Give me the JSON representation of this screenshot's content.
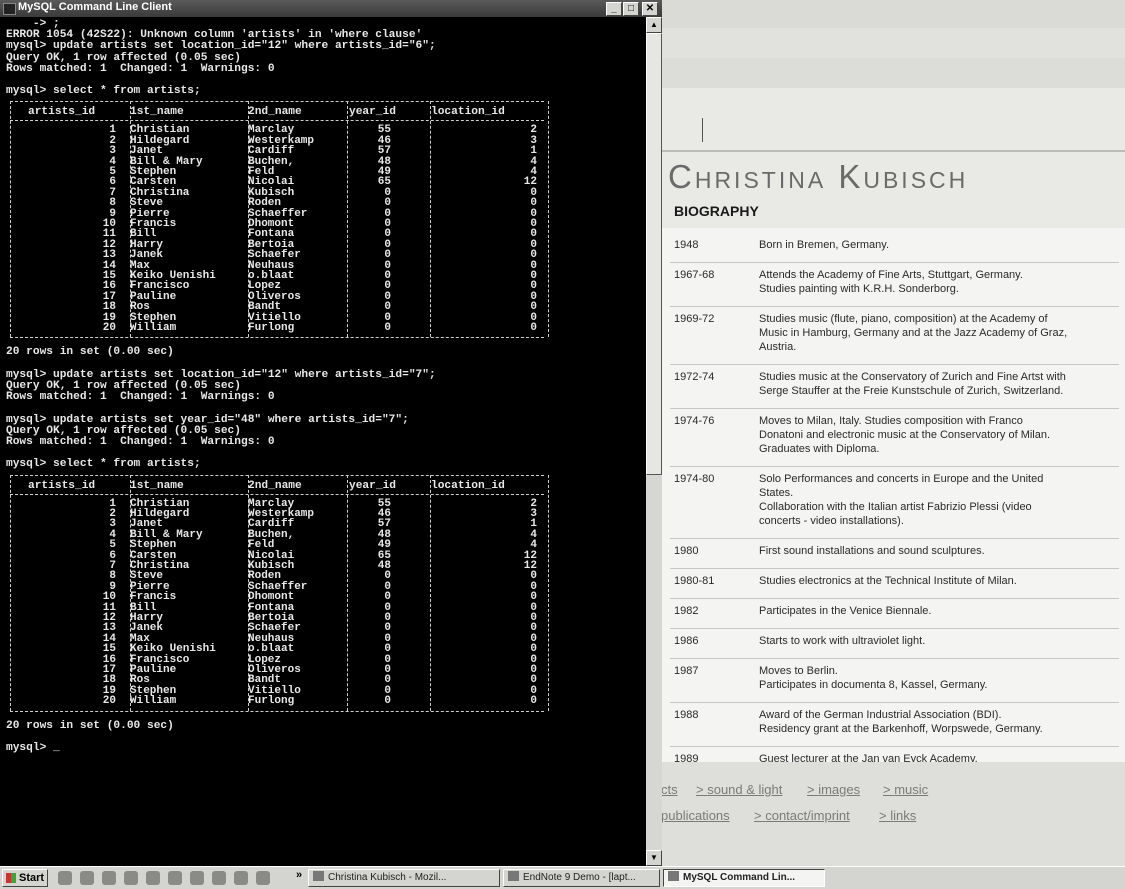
{
  "console": {
    "title": "MySQL Command Line Client",
    "buttons": {
      "minimize": "_",
      "maximize": "□",
      "close": "✕"
    },
    "pre_lines": [
      "    -> ;",
      "ERROR 1054 (42S22): Unknown column 'artists' in 'where clause'",
      "mysql> update artists set location_id=\"12\" where artists_id=\"6\";",
      "Query OK, 1 row affected (0.05 sec)",
      "Rows matched: 1  Changed: 1  Warnings: 0",
      "",
      "mysql> select * from artists;"
    ],
    "mid_lines": [
      "20 rows in set (0.00 sec)",
      "",
      "mysql> update artists set location_id=\"12\" where artists_id=\"7\";",
      "Query OK, 1 row affected (0.05 sec)",
      "Rows matched: 1  Changed: 1  Warnings: 0",
      "",
      "mysql> update artists set year_id=\"48\" where artists_id=\"7\";",
      "Query OK, 1 row affected (0.05 sec)",
      "Rows matched: 1  Changed: 1  Warnings: 0",
      "",
      "mysql> select * from artists;"
    ],
    "end_lines": [
      "20 rows in set (0.00 sec)",
      "",
      "mysql> _"
    ],
    "columns": [
      "artists_id",
      "1st_name",
      "2nd_name",
      "year_id",
      "location_id"
    ],
    "table1": {
      "artists_id": [
        "1",
        "2",
        "3",
        "4",
        "5",
        "6",
        "7",
        "8",
        "9",
        "10",
        "11",
        "12",
        "13",
        "14",
        "15",
        "16",
        "17",
        "18",
        "19",
        "20"
      ],
      "first_name": [
        "Christian",
        "Hildegard",
        "Janet",
        "Bill & Mary",
        "Stephen",
        "Carsten",
        "Christina",
        "Steve",
        "Pierre",
        "Francis",
        "Bill",
        "Harry",
        "Janek",
        "Max",
        "Keiko Uenishi",
        "Francisco",
        "Pauline",
        "Ros",
        "Stephen",
        "William"
      ],
      "second_name": [
        "Marclay",
        "Westerkamp",
        "Cardiff",
        "Buchen,",
        "Feld",
        "Nicolai",
        "Kubisch",
        "Roden",
        "Schaeffer",
        "Dhomont",
        "Fontana",
        "Bertoia",
        "Schaefer",
        "Neuhaus",
        "o.blaat",
        "Lopez",
        "Oliveros",
        "Bandt",
        "Vitiello",
        "Furlong"
      ],
      "year_id": [
        "55",
        "46",
        "57",
        "48",
        "49",
        "65",
        "0",
        "0",
        "0",
        "0",
        "0",
        "0",
        "0",
        "0",
        "0",
        "0",
        "0",
        "0",
        "0",
        "0"
      ],
      "location_id": [
        "2",
        "3",
        "1",
        "4",
        "4",
        "12",
        "0",
        "0",
        "0",
        "0",
        "0",
        "0",
        "0",
        "0",
        "0",
        "0",
        "0",
        "0",
        "0",
        "0"
      ]
    },
    "table2": {
      "artists_id": [
        "1",
        "2",
        "3",
        "4",
        "5",
        "6",
        "7",
        "8",
        "9",
        "10",
        "11",
        "12",
        "13",
        "14",
        "15",
        "16",
        "17",
        "18",
        "19",
        "20"
      ],
      "first_name": [
        "Christian",
        "Hildegard",
        "Janet",
        "Bill & Mary",
        "Stephen",
        "Carsten",
        "Christina",
        "Steve",
        "Pierre",
        "Francis",
        "Bill",
        "Harry",
        "Janek",
        "Max",
        "Keiko Uenishi",
        "Francisco",
        "Pauline",
        "Ros",
        "Stephen",
        "William"
      ],
      "second_name": [
        "Marclay",
        "Westerkamp",
        "Cardiff",
        "Buchen,",
        "Feld",
        "Nicolai",
        "Kubisch",
        "Roden",
        "Schaeffer",
        "Dhomont",
        "Fontana",
        "Bertoia",
        "Schaefer",
        "Neuhaus",
        "o.blaat",
        "Lopez",
        "Oliveros",
        "Bandt",
        "Vitiello",
        "Furlong"
      ],
      "year_id": [
        "55",
        "46",
        "57",
        "48",
        "49",
        "65",
        "48",
        "0",
        "0",
        "0",
        "0",
        "0",
        "0",
        "0",
        "0",
        "0",
        "0",
        "0",
        "0",
        "0"
      ],
      "location_id": [
        "2",
        "3",
        "1",
        "4",
        "4",
        "12",
        "12",
        "0",
        "0",
        "0",
        "0",
        "0",
        "0",
        "0",
        "0",
        "0",
        "0",
        "0",
        "0",
        "0"
      ]
    }
  },
  "browser": {
    "artist_name": "Christina Kubisch",
    "section_title": "BIOGRAPHY",
    "biography": [
      {
        "year": "1948",
        "lines": [
          "Born in Bremen, Germany."
        ]
      },
      {
        "year": "1967-68",
        "lines": [
          "Attends the Academy of Fine Arts, Stuttgart, Germany.",
          "Studies painting with K.R.H. Sonderborg."
        ]
      },
      {
        "year": "1969-72",
        "lines": [
          "Studies music (flute, piano, composition) at the Academy of",
          "Music in Hamburg, Germany and at the Jazz Academy of Graz,",
          "Austria."
        ]
      },
      {
        "year": "1972-74",
        "lines": [
          "Studies music at the Conservatory of Zurich and Fine Artst with",
          "Serge Stauffer at the Freie Kunstschule of Zurich, Switzerland."
        ]
      },
      {
        "year": "1974-76",
        "lines": [
          "Moves to Milan, Italy. Studies composition with Franco",
          "Donatoni and electronic music at the Conservatory of Milan.",
          "Graduates with Diploma."
        ]
      },
      {
        "year": "1974-80",
        "lines": [
          "Solo Performances and concerts in Europe and the United",
          "States.",
          "Collaboration with the Italian artist Fabrizio Plessi (video",
          "concerts - video installations)."
        ]
      },
      {
        "year": "1980",
        "lines": [
          "First sound installations and sound sculptures."
        ]
      },
      {
        "year": "1980-81",
        "lines": [
          "Studies electronics at the Technical Institute of Milan."
        ]
      },
      {
        "year": "1982",
        "lines": [
          "Participates in the Venice Biennale."
        ]
      },
      {
        "year": "1986",
        "lines": [
          "Starts to work with ultraviolet light."
        ]
      },
      {
        "year": "1987",
        "lines": [
          "Moves to Berlin.",
          "Participates in documenta 8, Kassel, Germany."
        ]
      },
      {
        "year": "1988",
        "lines": [
          "Award of the German Industrial Association (BDI).",
          "Residency grant at the Barkenhoff, Worpswede, Germany."
        ]
      },
      {
        "year": "1989",
        "lines": [
          "Guest lecturer at the Jan van Eyck Academy,"
        ]
      }
    ],
    "nav_row1": [
      {
        "arrow": "",
        "label": "cts"
      },
      {
        "arrow": ">",
        "label": "sound & light"
      },
      {
        "arrow": ">",
        "label": "images"
      },
      {
        "arrow": ">",
        "label": "music"
      }
    ],
    "nav_row2": [
      {
        "arrow": "",
        "label": "publications"
      },
      {
        "arrow": ">",
        "label": "contact/imprint"
      },
      {
        "arrow": ">",
        "label": "links"
      }
    ]
  },
  "taskbar": {
    "start_label": "Start",
    "more": "»",
    "tasks": [
      {
        "label": "Christina Kubisch - Mozil...",
        "active": false
      },
      {
        "label": "EndNote 9 Demo - [lapt...",
        "active": false
      },
      {
        "label": "MySQL Command Lin...",
        "active": true
      }
    ]
  }
}
